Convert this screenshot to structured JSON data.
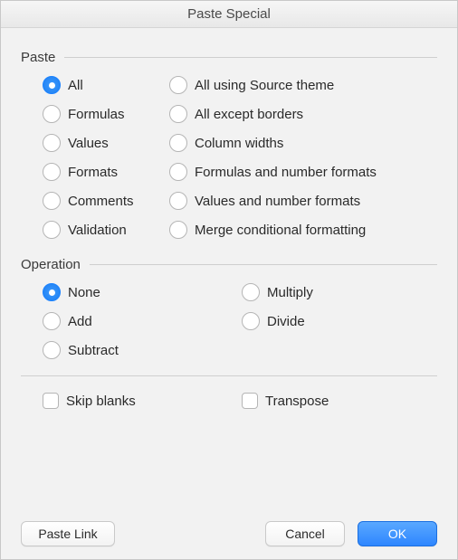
{
  "title": "Paste Special",
  "sections": {
    "paste": {
      "heading": "Paste",
      "selected": "all",
      "left": [
        {
          "id": "all",
          "label": "All"
        },
        {
          "id": "formulas",
          "label": "Formulas"
        },
        {
          "id": "values",
          "label": "Values"
        },
        {
          "id": "formats",
          "label": "Formats"
        },
        {
          "id": "comments",
          "label": "Comments"
        },
        {
          "id": "validation",
          "label": "Validation"
        }
      ],
      "right": [
        {
          "id": "all-source-theme",
          "label": "All using Source theme"
        },
        {
          "id": "all-except-borders",
          "label": "All except borders"
        },
        {
          "id": "column-widths",
          "label": "Column widths"
        },
        {
          "id": "formulas-number-formats",
          "label": "Formulas and number formats"
        },
        {
          "id": "values-number-formats",
          "label": "Values and number formats"
        },
        {
          "id": "merge-conditional",
          "label": "Merge conditional formatting"
        }
      ]
    },
    "operation": {
      "heading": "Operation",
      "selected": "none",
      "items": [
        {
          "id": "none",
          "label": "None"
        },
        {
          "id": "multiply",
          "label": "Multiply"
        },
        {
          "id": "add",
          "label": "Add"
        },
        {
          "id": "divide",
          "label": "Divide"
        },
        {
          "id": "subtract",
          "label": "Subtract"
        }
      ]
    }
  },
  "checkboxes": {
    "skip_blanks": {
      "label": "Skip blanks",
      "checked": false
    },
    "transpose": {
      "label": "Transpose",
      "checked": false
    }
  },
  "buttons": {
    "paste_link": "Paste Link",
    "cancel": "Cancel",
    "ok": "OK"
  }
}
